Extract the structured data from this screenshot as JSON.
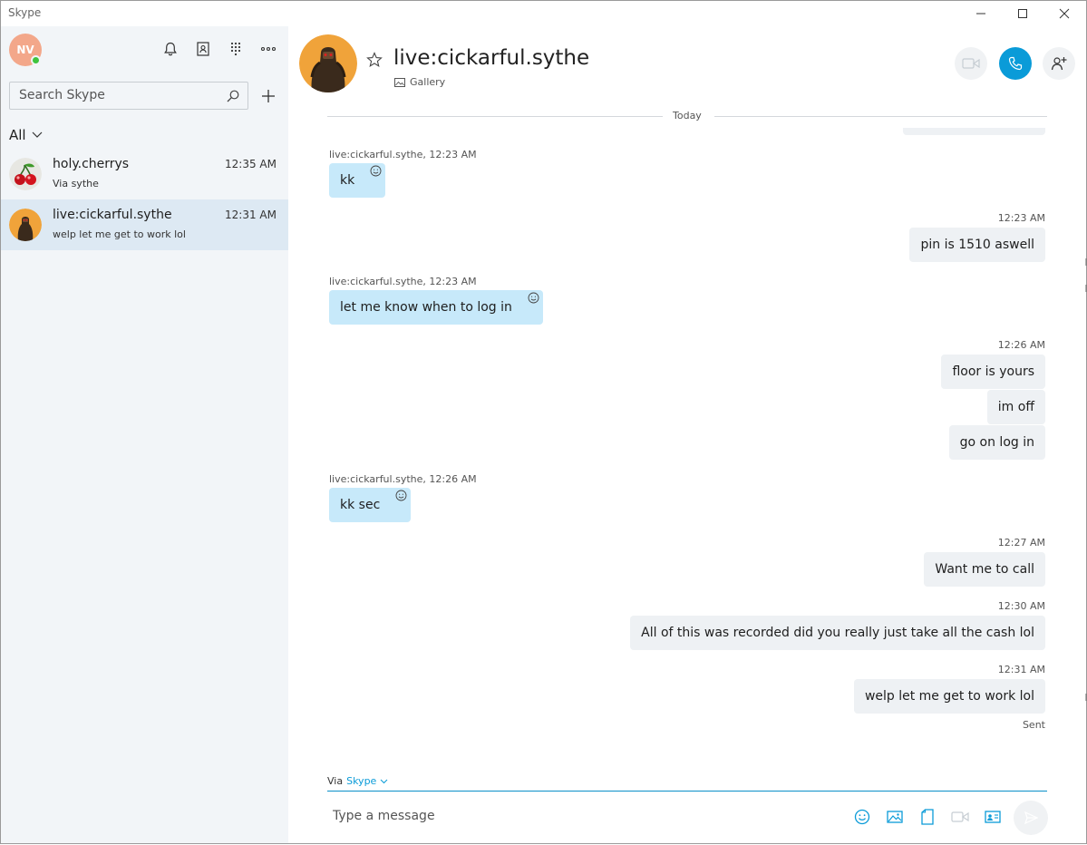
{
  "window": {
    "title": "Skype",
    "minimize_glyph": "—",
    "maximize_glyph": "☐",
    "close_glyph": "✕"
  },
  "sidebar": {
    "me_initials": "NV",
    "search_placeholder": "Search Skype",
    "filter_label": "All",
    "conversations": [
      {
        "name": "holy.cherrys",
        "time": "12:35 AM",
        "preview": "Via sythe",
        "avatar": "cherry-icon",
        "active": false
      },
      {
        "name": "live:cickarful.sythe",
        "time": "12:31 AM",
        "preview": "welp let me get to work lol",
        "avatar": "character-avatar",
        "active": true
      }
    ]
  },
  "chat": {
    "title": "live:cickarful.sythe",
    "gallery_label": "Gallery",
    "date_divider": "Today",
    "messages": [
      {
        "dir": "in",
        "meta": "live:cickarful.sythe, 12:23 AM",
        "text": "kk"
      },
      {
        "dir": "out",
        "meta": "12:23 AM",
        "text": "pin is 1510 aswell"
      },
      {
        "dir": "in",
        "meta": "live:cickarful.sythe, 12:23 AM",
        "text": "let me know when to log in"
      },
      {
        "dir": "out",
        "meta": "12:26 AM",
        "text": "floor is yours"
      },
      {
        "dir": "out",
        "meta": "",
        "text": "im off"
      },
      {
        "dir": "out",
        "meta": "",
        "text": "go on log in"
      },
      {
        "dir": "in",
        "meta": "live:cickarful.sythe, 12:26 AM",
        "text": "kk sec"
      },
      {
        "dir": "out",
        "meta": "12:27 AM",
        "text": "Want me to call"
      },
      {
        "dir": "out",
        "meta": "12:30 AM",
        "text": "All of this was recorded did you really just take all the cash lol"
      },
      {
        "dir": "out",
        "meta": "12:31 AM",
        "text": "welp let me get to work lol"
      }
    ],
    "status_sent": "Sent",
    "via_prefix": "Via",
    "via_service": "Skype",
    "compose_placeholder": "Type a message"
  },
  "colors": {
    "accent": "#0a9bd8",
    "incoming_bubble": "#c7e9fa",
    "outgoing_bubble": "#eef1f4",
    "sidebar_bg": "#f2f5f8",
    "presence_online": "#3ec43e"
  }
}
